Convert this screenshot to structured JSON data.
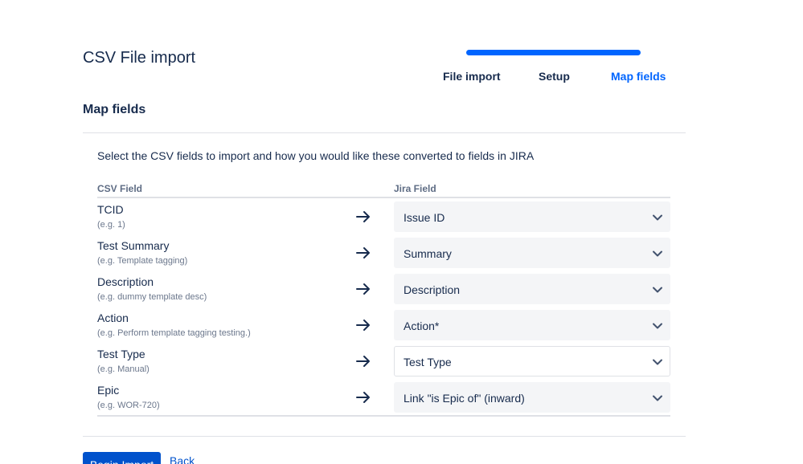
{
  "header": {
    "title": "CSV File import"
  },
  "stepper": {
    "progress_fraction": 1.0,
    "accent_color": "#0065ff",
    "steps": [
      {
        "label": "File import",
        "state": "done"
      },
      {
        "label": "Setup",
        "state": "done"
      },
      {
        "label": "Map fields",
        "state": "current"
      }
    ]
  },
  "section": {
    "title": "Map fields",
    "intro": "Select the CSV fields to import and how you would like these converted to fields in JIRA"
  },
  "table": {
    "csv_header": "CSV Field",
    "jira_header": "Jira Field",
    "rows": [
      {
        "csv_field": "TCID",
        "example": "(e.g. 1)",
        "jira_field": "Issue ID",
        "icon": "arrow-right-icon"
      },
      {
        "csv_field": "Test Summary",
        "example": "(e.g. Template tagging)",
        "jira_field": "Summary",
        "icon": "arrow-right-icon"
      },
      {
        "csv_field": "Description",
        "example": "(e.g. dummy template desc)",
        "jira_field": "Description",
        "icon": "arrow-right-icon"
      },
      {
        "csv_field": "Action",
        "example": "(e.g. Perform template tagging testing.)",
        "jira_field": "Action*",
        "icon": "arrow-right-icon"
      },
      {
        "csv_field": "Test Type",
        "example": "(e.g. Manual)",
        "jira_field": "Test Type",
        "icon": "arrow-right-icon"
      },
      {
        "csv_field": "Epic",
        "example": "(e.g. WOR-720)",
        "jira_field": "Link \"is Epic of\" (inward)",
        "icon": "arrow-right-icon"
      }
    ]
  },
  "actions": {
    "begin_label": "Begin Import",
    "back_label": "Back",
    "primary_color": "#0052cc"
  }
}
